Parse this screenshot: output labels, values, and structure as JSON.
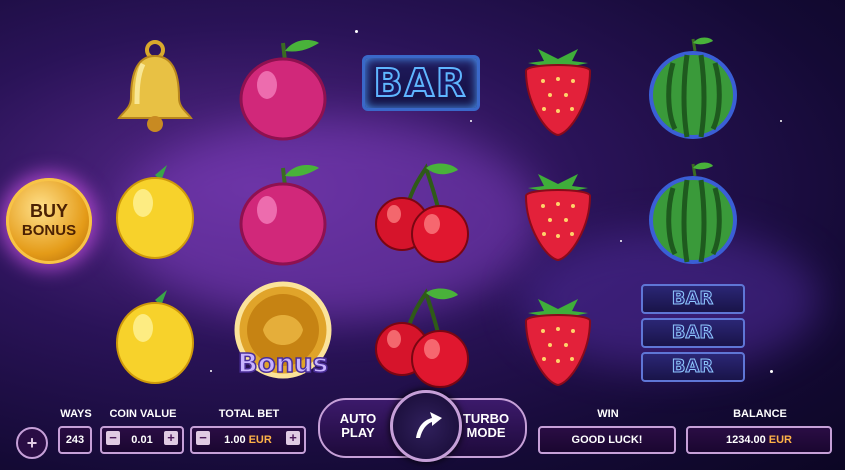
{
  "buy_bonus": {
    "line1": "BUY",
    "line2": "BONUS"
  },
  "reels": [
    [
      "bell",
      "lemon",
      "lemon"
    ],
    [
      "plum",
      "plum",
      "bonus"
    ],
    [
      "bar",
      "cherry",
      "cherry"
    ],
    [
      "strawberry",
      "strawberry",
      "strawberry"
    ],
    [
      "watermelon",
      "watermelon",
      "triple-bar"
    ]
  ],
  "symbols": {
    "bar_text": "BAR",
    "bonus_text": "Bonus"
  },
  "controls": {
    "ways_label": "WAYS",
    "ways_value": "243",
    "coin_value_label": "COIN VALUE",
    "coin_value": "0.01",
    "total_bet_label": "TOTAL BET",
    "total_bet": "1.00",
    "currency": "EUR",
    "auto_play_line1": "AUTO",
    "auto_play_line2": "PLAY",
    "turbo_line1": "TURBO",
    "turbo_line2": "MODE",
    "win_label": "WIN",
    "win_value": "GOOD LUCK!",
    "balance_label": "BALANCE",
    "balance_value": "1234.00",
    "minus": "−",
    "plus": "+"
  }
}
